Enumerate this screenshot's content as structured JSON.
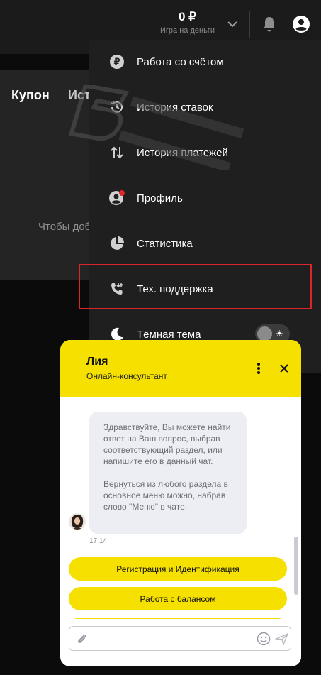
{
  "header": {
    "balance_amount": "0 ₽",
    "balance_mode": "Игра на деньги",
    "icons": [
      "chevron-down-icon",
      "bell-icon",
      "account-icon"
    ]
  },
  "coupon_panel": {
    "tab_coupon": "Купон",
    "tab_history": "История",
    "hint": "Чтобы добавить"
  },
  "menu": {
    "items": [
      {
        "label": "Работа со счётом",
        "icon": "ruble-icon"
      },
      {
        "label": "История ставок",
        "icon": "history-icon"
      },
      {
        "label": "История платежей",
        "icon": "transfer-arrows-icon"
      },
      {
        "label": "Профиль",
        "icon": "profile-icon",
        "has_notification_dot": true
      },
      {
        "label": "Статистика",
        "icon": "pie-chart-icon"
      },
      {
        "label": "Тех. поддержка",
        "icon": "support-phone-icon",
        "highlighted": true
      },
      {
        "label": "Тёмная тема",
        "icon": "moon-icon",
        "toggle": true
      }
    ]
  },
  "chat": {
    "agent_name": "Лия",
    "agent_role": "Онлайн-консультант",
    "message_p1": "Здравствуйте, Вы можете найти ответ на Ваш вопрос, выбрав соответствующий раздел, или напишите его в данный чат.",
    "message_p2": "Вернуться из любого раздела в основное меню можно, набрав слово \"Меню\" в чате.",
    "message_time": "17:14",
    "quick_replies": [
      "Регистрация и Идентификация",
      "Работа с балансом"
    ],
    "input_placeholder": ""
  },
  "colors": {
    "accent_yellow": "#f5e000",
    "highlight_red": "#d9262b",
    "notification_red": "#e0252b",
    "menu_bg": "#1f1f1f",
    "page_bg": "#0b0b0b"
  }
}
